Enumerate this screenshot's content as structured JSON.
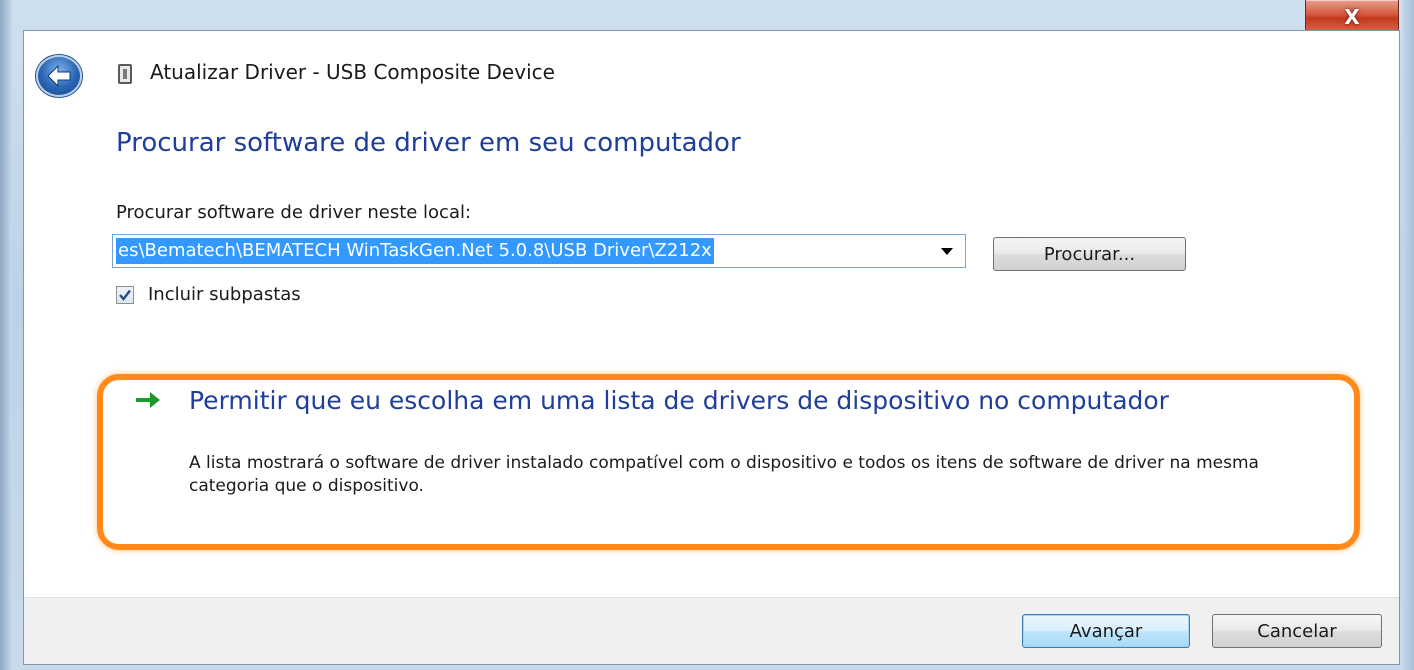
{
  "window": {
    "title": "Atualizar Driver -  USB Composite Device",
    "close_label": "X"
  },
  "main": {
    "heading": "Procurar software de driver em seu computador",
    "path_label": "Procurar software de driver neste local:",
    "path_value": "es\\Bematech\\BEMATECH WinTaskGen.Net 5.0.8\\USB Driver\\Z212x",
    "browse_label": "Procurar...",
    "include_subfolders": {
      "label": "Incluir subpastas",
      "checked": true
    },
    "command_link": {
      "title": "Permitir que eu escolha em uma lista de drivers de dispositivo no computador",
      "description": "A lista mostrará o software de driver instalado compatível com o dispositivo e todos os itens de software de driver na mesma categoria que o dispositivo.",
      "highlight_color": "#ff8a1a",
      "arrow_color": "#1e9a2a"
    }
  },
  "footer": {
    "next_label": "Avançar",
    "cancel_label": "Cancelar"
  },
  "icons": {
    "back": "back-arrow-icon",
    "device": "usb-device-icon",
    "close": "close-icon",
    "dropdown": "chevron-down-icon",
    "check": "checkmark-icon",
    "command_arrow": "green-arrow-icon"
  }
}
